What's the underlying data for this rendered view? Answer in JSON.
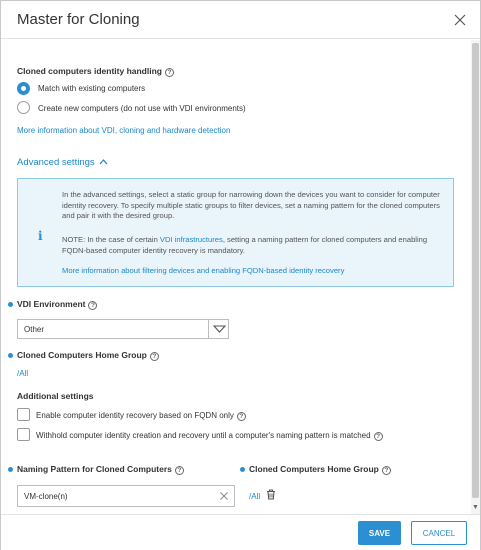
{
  "dialog": {
    "title": "Master for Cloning"
  },
  "identity": {
    "heading": "Cloned computers identity handling",
    "options": [
      {
        "label": "Match with existing computers",
        "selected": true
      },
      {
        "label": "Create new computers (do not use with VDI environments)",
        "selected": false
      }
    ],
    "more_link": "More information about VDI, cloning and hardware detection"
  },
  "advanced": {
    "toggle_label": "Advanced settings",
    "info": {
      "paragraph1": "In the advanced settings, select a static group for narrowing down the devices you want to consider for computer identity recovery. To specify multiple static groups to filter devices, set a naming pattern for the cloned computers and pair it with the desired group.",
      "note_prefix": "NOTE: In the case of certain ",
      "note_link": "VDI infrastructures",
      "note_suffix": ", setting a naming pattern for cloned computers and enabling FQDN-based computer identity recovery is mandatory.",
      "more_link": "More information about filtering devices and enabling FQDN-based identity recovery"
    }
  },
  "vdi": {
    "label": "VDI Environment",
    "selected": "Other"
  },
  "home_group": {
    "label": "Cloned Computers Home Group",
    "value": "/All"
  },
  "additional": {
    "heading": "Additional settings",
    "options": [
      {
        "label": "Enable computer identity recovery based on FQDN only",
        "checked": false
      },
      {
        "label": "Withhold computer identity creation and recovery until a computer's naming pattern is matched",
        "checked": false
      }
    ]
  },
  "naming": {
    "label": "Naming Pattern for Cloned Computers",
    "value": "VM-clone(n)",
    "group_label": "Cloned Computers Home Group",
    "group_value": "/All"
  },
  "footer": {
    "save": "SAVE",
    "cancel": "CANCEL"
  },
  "colors": {
    "accent": "#2b8fd1",
    "info_bg": "#e9f4fb",
    "info_border": "#8ec9ea"
  }
}
